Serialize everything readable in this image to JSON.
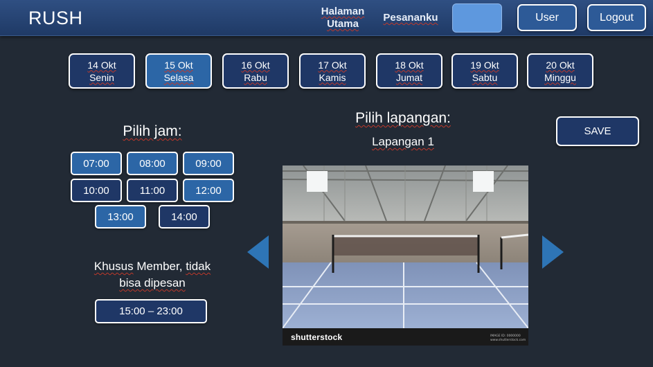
{
  "header": {
    "brand": "RUSH",
    "nav_home_line1": "Halaman",
    "nav_home_line2": "Utama",
    "nav_orders": "Pesananku",
    "user_button": "User",
    "logout_button": "Logout"
  },
  "days": [
    {
      "date": "14 Okt",
      "day": "Senin",
      "selected": false
    },
    {
      "date": "15 Okt",
      "day": "Selasa",
      "selected": true
    },
    {
      "date": "16 Okt",
      "day": "Rabu",
      "selected": false
    },
    {
      "date": "17 Okt",
      "day": "Kamis",
      "selected": false
    },
    {
      "date": "18 Okt",
      "day": "Jumat",
      "selected": false
    },
    {
      "date": "19 Okt",
      "day": "Sabtu",
      "selected": false
    },
    {
      "date": "20 Okt",
      "day": "Minggu",
      "selected": false
    }
  ],
  "time_section": {
    "title": "Pilih jam:",
    "slots": [
      {
        "label": "07:00",
        "available": true
      },
      {
        "label": "08:00",
        "available": true
      },
      {
        "label": "09:00",
        "available": true
      },
      {
        "label": "10:00",
        "available": false
      },
      {
        "label": "11:00",
        "available": false
      },
      {
        "label": "12:00",
        "available": true
      },
      {
        "label": "13:00",
        "available": true
      },
      {
        "label": "14:00",
        "available": false
      }
    ],
    "member_note_1": "Khusus",
    "member_note_2": " Member, ",
    "member_note_3": "tidak",
    "member_note_4": "bisa dipesan",
    "member_slot": "15:00 – 23:00"
  },
  "court_section": {
    "title": "Pilih lapangan:",
    "court_name": "Lapangan 1",
    "image_watermark": "shutterstock",
    "prev_icon": "arrow-left-icon",
    "next_icon": "arrow-right-icon"
  },
  "save_button": "SAVE",
  "colors": {
    "background": "#222a35",
    "header": "#2f4f82",
    "button_dark": "#1f3766",
    "button_light": "#2c66a6",
    "arrow": "#2e75b6",
    "search_box": "#5e98de"
  }
}
